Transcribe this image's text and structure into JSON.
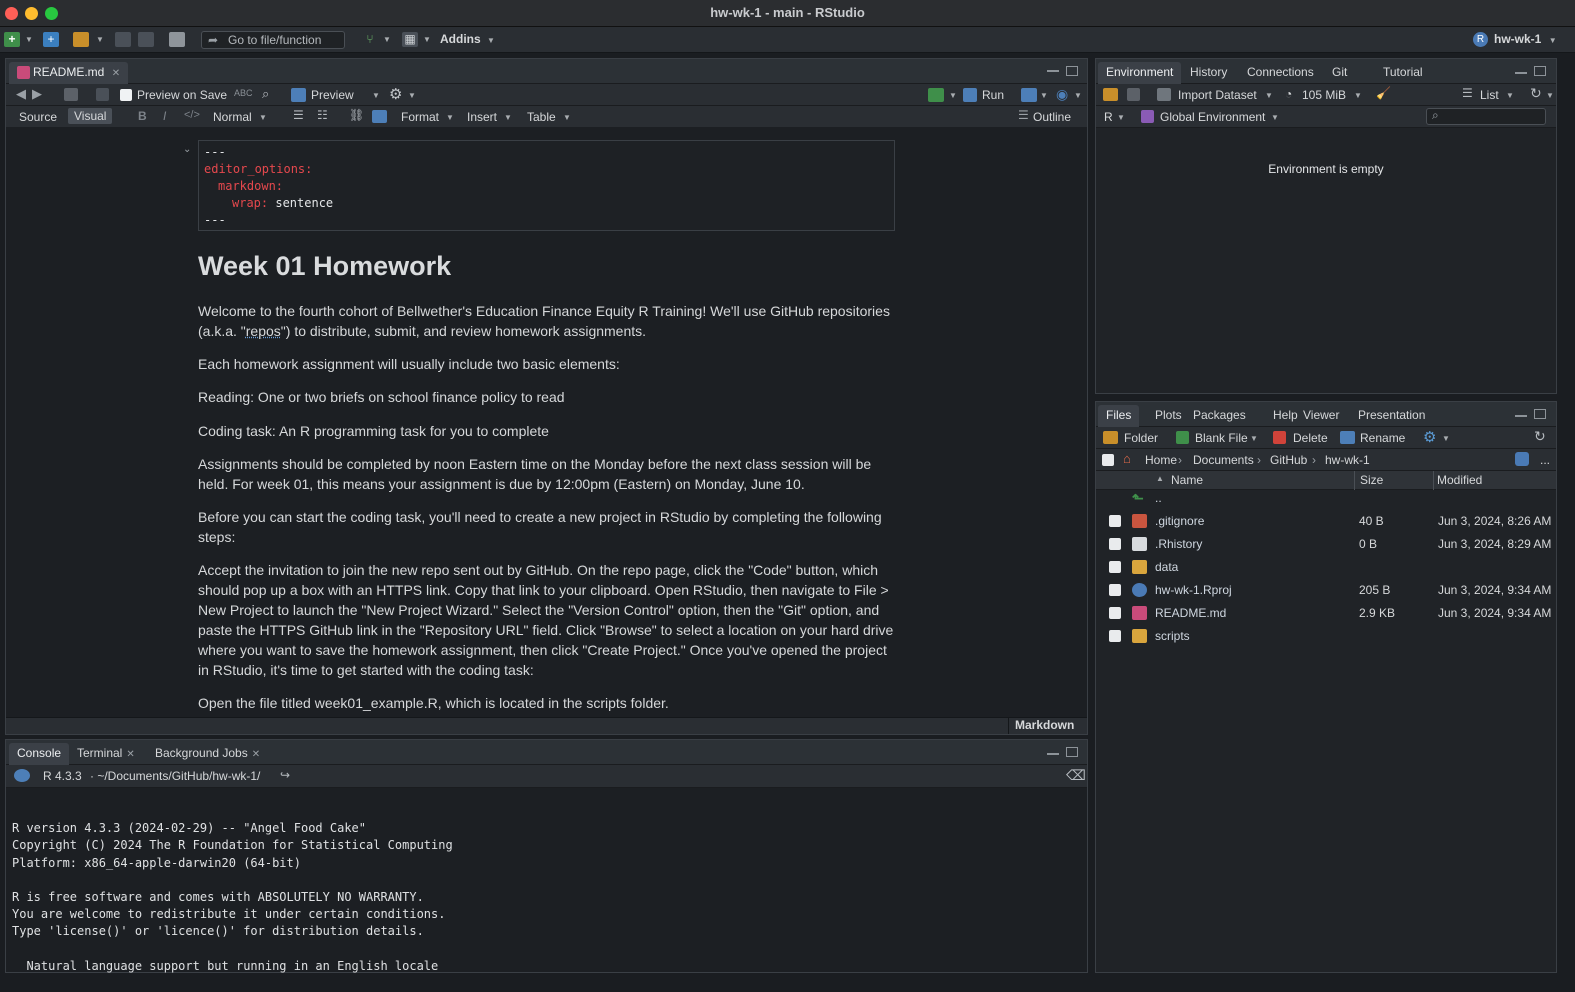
{
  "window": {
    "title": "hw-wk-1 - main - RStudio"
  },
  "main_toolbar": {
    "goto_placeholder": "Go to file/function",
    "addins_label": "Addins",
    "project_label": "hw-wk-1"
  },
  "source_pane": {
    "tab_label": "README.md",
    "preview_on_save_label": "Preview on Save",
    "preview_label": "Preview",
    "run_label": "Run",
    "source_label": "Source",
    "visual_label": "Visual",
    "paragraph_style": "Normal",
    "format_label": "Format",
    "insert_label": "Insert",
    "table_label": "Table",
    "outline_label": "Outline",
    "doc_type_label": "Markdown",
    "yaml": {
      "open": "---",
      "key1": "editor_options:",
      "key2": "markdown:",
      "key3": "wrap:",
      "val3": "sentence",
      "close": "---"
    },
    "heading": "Week 01 Homework",
    "paragraphs": {
      "p1_before": "Welcome to the fourth cohort of Bellwether's Education Finance Equity R Training! We'll use GitHub repositories (a.k.a. \"",
      "p1_link": "repos",
      "p1_after": "\") to distribute, submit, and review homework assignments.",
      "p2": "Each homework assignment will usually include two basic elements:",
      "p3": "Reading: One or two briefs on school finance policy to read",
      "p4": "Coding task: An R programming task for you to complete",
      "p5": "Assignments should be completed by noon Eastern time on the Monday before the next class session will be held. For week 01, this means your assignment is due by 12:00pm (Eastern) on Monday, June 10.",
      "p6": "Before you can start the coding task, you'll need to create a new project in RStudio by completing the following steps:",
      "p7": "Accept the invitation to join the new repo sent out by GitHub. On the repo page, click the \"Code\" button, which should pop up a box with an HTTPS link. Copy that link to your clipboard. Open RStudio, then navigate to File > New Project to launch the \"New Project Wizard.\" Select the \"Version Control\" option, then the \"Git\" option, and paste the HTTPS GitHub link in the \"Repository URL\" field. Click \"Browse\" to select a location on your hard drive where you want to save the homework assignment, then click \"Create Project.\" Once you've opened the project in RStudio, it's time to get started with the coding task:",
      "p8": "Open the file titled week01_example.R, which is located in the scripts folder."
    }
  },
  "console_pane": {
    "tabs": [
      "Console",
      "Terminal",
      "Background Jobs"
    ],
    "r_version_label": "R 4.3.3",
    "path_label": "· ~/Documents/GitHub/hw-wk-1/",
    "lines": [
      "R version 4.3.3 (2024-02-29) -- \"Angel Food Cake\"",
      "Copyright (C) 2024 The R Foundation for Statistical Computing",
      "Platform: x86_64-apple-darwin20 (64-bit)",
      "",
      "R is free software and comes with ABSOLUTELY NO WARRANTY.",
      "You are welcome to redistribute it under certain conditions.",
      "Type 'license()' or 'licence()' for distribution details.",
      "",
      "  Natural language support but running in an English locale"
    ]
  },
  "env_pane": {
    "tabs": [
      "Environment",
      "History",
      "Connections",
      "Git",
      "Tutorial"
    ],
    "import_label": "Import Dataset",
    "memory_label": "105 MiB",
    "view_mode": "List",
    "language": "R",
    "scope": "Global Environment",
    "empty_message": "Environment is empty"
  },
  "files_pane": {
    "tabs": [
      "Files",
      "Plots",
      "Packages",
      "Help",
      "Viewer",
      "Presentation"
    ],
    "folder_label": "Folder",
    "blank_file_label": "Blank File",
    "delete_label": "Delete",
    "rename_label": "Rename",
    "breadcrumb": [
      "Home",
      "Documents",
      "GitHub",
      "hw-wk-1"
    ],
    "more_label": "...",
    "columns": {
      "name": "Name",
      "size": "Size",
      "modified": "Modified"
    },
    "up_label": "..",
    "rows": [
      {
        "name": ".gitignore",
        "size": "40 B",
        "modified": "Jun 3, 2024, 8:26 AM",
        "icon": "gitignore-icon"
      },
      {
        "name": ".Rhistory",
        "size": "0 B",
        "modified": "Jun 3, 2024, 8:29 AM",
        "icon": "rhistory-icon"
      },
      {
        "name": "data",
        "size": "",
        "modified": "",
        "icon": "folder-icon"
      },
      {
        "name": "hw-wk-1.Rproj",
        "size": "205 B",
        "modified": "Jun 3, 2024, 9:34 AM",
        "icon": "rproj-icon"
      },
      {
        "name": "README.md",
        "size": "2.9 KB",
        "modified": "Jun 3, 2024, 9:34 AM",
        "icon": "markdown-icon"
      },
      {
        "name": "scripts",
        "size": "",
        "modified": "",
        "icon": "folder-icon"
      }
    ]
  },
  "colors": {
    "background": "#1a1d21",
    "pane": "#202327",
    "accent_blue": "#5b9bd5",
    "yaml_key": "#e5484d"
  }
}
